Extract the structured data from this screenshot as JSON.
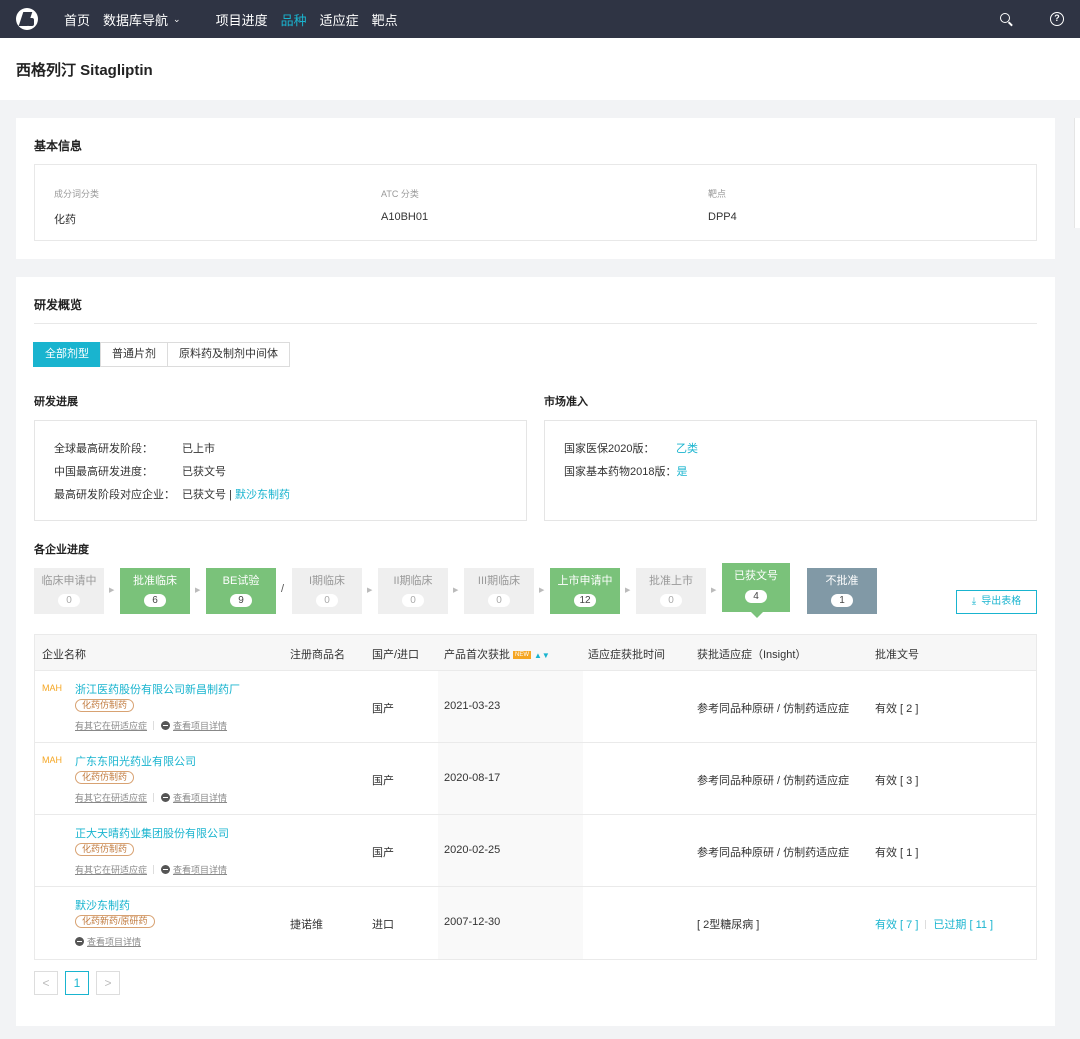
{
  "nav": {
    "items": [
      "首页",
      "数据库导航",
      "项目进度",
      "品种",
      "适应症",
      "靶点"
    ],
    "active_index": 3,
    "search_icon": "search-icon",
    "help_icon": "help-icon"
  },
  "page": {
    "title": "西格列汀 Sitagliptin"
  },
  "basic": {
    "title": "基本信息",
    "fields": [
      {
        "label": "成分词分类",
        "value": "化药"
      },
      {
        "label": "ATC 分类",
        "value": "A10BH01"
      },
      {
        "label": "靶点",
        "value": "DPP4"
      }
    ]
  },
  "overview": {
    "title": "研发概览",
    "tabs": [
      "全部剂型",
      "普通片剂",
      "原料药及制剂中间体"
    ],
    "active_tab": 0,
    "progress": {
      "title": "研发进展",
      "rows": [
        {
          "key": "全球最高研发阶段：",
          "value": "已上市",
          "link": ""
        },
        {
          "key": "中国最高研发进度：",
          "value": "已获文号",
          "link": ""
        },
        {
          "key": "最高研发阶段对应企业：",
          "value": "已获文号 | ",
          "link": "默沙东制药"
        }
      ]
    },
    "market": {
      "title": "市场准入",
      "rows": [
        {
          "key": "国家医保2020版：",
          "value": "乙类"
        },
        {
          "key": "国家基本药物2018版：",
          "value": "是"
        }
      ]
    },
    "stages_title": "各企业进度",
    "stages": [
      {
        "label": "临床申请中",
        "count": "0",
        "style": "gray"
      },
      {
        "label": "批准临床",
        "count": "6",
        "style": "green"
      },
      {
        "label": "BE试验",
        "count": "9",
        "style": "green"
      },
      {
        "label": "I期临床",
        "count": "0",
        "style": "gray"
      },
      {
        "label": "II期临床",
        "count": "0",
        "style": "gray"
      },
      {
        "label": "III期临床",
        "count": "0",
        "style": "gray"
      },
      {
        "label": "上市申请中",
        "count": "12",
        "style": "green"
      },
      {
        "label": "批准上市",
        "count": "0",
        "style": "gray"
      },
      {
        "label": "已获文号",
        "count": "4",
        "style": "big"
      },
      {
        "label": "不批准",
        "count": "1",
        "style": "slate"
      }
    ],
    "separator": "/",
    "export_label": "导出表格"
  },
  "table": {
    "headers": [
      "企业名称",
      "注册商品名",
      "国产/进口",
      "产品首次获批",
      "适应症获批时间",
      "获批适应症（Insight）",
      "批准文号"
    ],
    "new_badge": "NEW",
    "rows": [
      {
        "mah": "MAH",
        "company": "浙江医药股份有限公司新昌制药厂",
        "type": "化药仿制药",
        "other_link": "有其它在研适应症",
        "detail_link": "查看项目详情",
        "brand": "",
        "origin": "国产",
        "first_approval": "2021-03-23",
        "indication_time": "",
        "indication": "参考同品种原研 / 仿制药适应症",
        "indication_is_link": false,
        "approvals": [
          {
            "text": "有效 [ 2 ]"
          }
        ]
      },
      {
        "mah": "MAH",
        "company": "广东东阳光药业有限公司",
        "type": "化药仿制药",
        "other_link": "有其它在研适应症",
        "detail_link": "查看项目详情",
        "brand": "",
        "origin": "国产",
        "first_approval": "2020-08-17",
        "indication_time": "",
        "indication": "参考同品种原研 / 仿制药适应症",
        "indication_is_link": false,
        "approvals": [
          {
            "text": "有效 [ 3 ]"
          }
        ]
      },
      {
        "mah": "",
        "company": "正大天晴药业集团股份有限公司",
        "type": "化药仿制药",
        "other_link": "有其它在研适应症",
        "detail_link": "查看项目详情",
        "brand": "",
        "origin": "国产",
        "first_approval": "2020-02-25",
        "indication_time": "",
        "indication": "参考同品种原研 / 仿制药适应症",
        "indication_is_link": false,
        "approvals": [
          {
            "text": "有效 [ 1 ]"
          }
        ]
      },
      {
        "mah": "",
        "company": "默沙东制药",
        "type": "化药新药/原研药",
        "other_link": "",
        "detail_link": "查看项目详情",
        "brand": "捷诺维",
        "origin": "进口",
        "first_approval": "2007-12-30",
        "indication_time": "",
        "indication": "[ 2型糖尿病 ]",
        "indication_is_link": true,
        "approvals": [
          {
            "text": "有效 [ 7 ]"
          },
          {
            "text": "已过期 [ 11 ]"
          }
        ]
      }
    ]
  },
  "pagination": {
    "prev": "<",
    "current": "1",
    "next": ">"
  },
  "colors": {
    "accent": "#19b4cf",
    "nav_bg": "#2f3444",
    "green": "#7ac27a",
    "slate": "#8199a6",
    "mah": "#f5a623"
  }
}
